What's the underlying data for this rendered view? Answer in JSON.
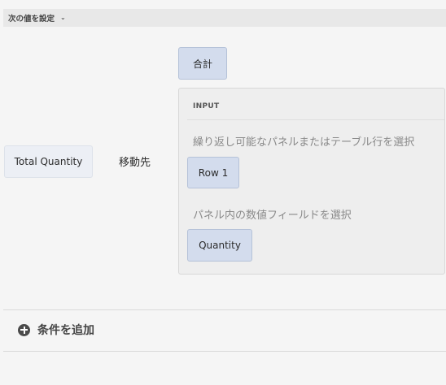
{
  "header": {
    "title": "次の値を設定",
    "chevron": "⌄"
  },
  "target_field": {
    "label": "合計"
  },
  "source_field": {
    "label": "Total Quantity"
  },
  "goto_label": "移動先",
  "input_panel": {
    "title": "INPUT",
    "select_panel_prompt": "繰り返し可能なパネルまたはテーブル行を選択",
    "selected_panel": "Row 1",
    "select_field_prompt": "パネル内の数値フィールドを選択",
    "selected_field": "Quantity"
  },
  "add_condition": {
    "icon": "plus-circle-icon",
    "label": "条件を追加"
  }
}
